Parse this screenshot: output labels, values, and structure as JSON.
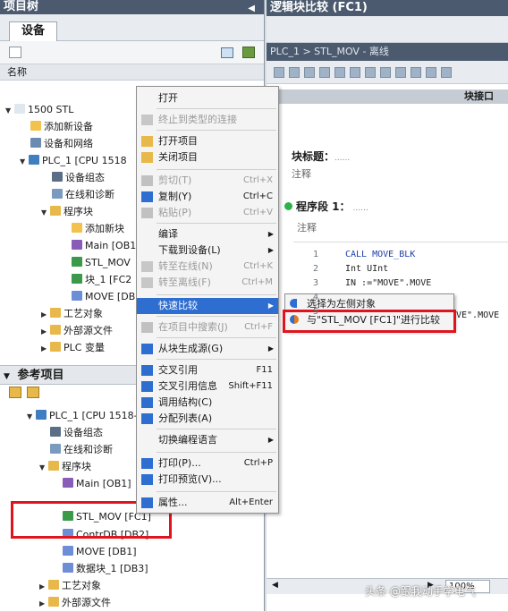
{
  "left": {
    "title": "项目树",
    "tab": "设备",
    "col_header": "名称",
    "tree": [
      {
        "label": "1500 STL",
        "icon": "project-icon"
      },
      {
        "label": "添加新设备",
        "icon": "add-device-icon"
      },
      {
        "label": "设备和网络",
        "icon": "network-icon"
      },
      {
        "label": "PLC_1 [CPU 1518",
        "icon": "plc-icon"
      },
      {
        "label": "设备组态",
        "icon": "device-config-icon"
      },
      {
        "label": "在线和诊断",
        "icon": "diagnostics-icon"
      },
      {
        "label": "程序块",
        "icon": "folder-icon"
      },
      {
        "label": "添加新块",
        "icon": "add-block-icon"
      },
      {
        "label": "Main [OB1",
        "icon": "ob-icon"
      },
      {
        "label": "STL_MOV",
        "icon": "fc-icon"
      },
      {
        "label": "块_1 [FC2",
        "icon": "fc-icon"
      },
      {
        "label": "MOVE [DB",
        "icon": "db-icon"
      },
      {
        "label": "工艺对象",
        "icon": "folder-icon"
      },
      {
        "label": "外部源文件",
        "icon": "folder-icon"
      },
      {
        "label": "PLC 变量",
        "icon": "folder-icon"
      }
    ],
    "ref_title": "参考项目",
    "ref_tree": [
      {
        "label": "PLC_1 [CPU 1518-",
        "icon": "plc-icon"
      },
      {
        "label": "设备组态",
        "icon": "device-config-icon"
      },
      {
        "label": "在线和诊断",
        "icon": "diagnostics-icon"
      },
      {
        "label": "程序块",
        "icon": "folder-icon"
      },
      {
        "label": "Main [OB1]",
        "icon": "ob-icon"
      },
      {
        "label": "STL_MOV [FC1]",
        "icon": "fc-icon"
      },
      {
        "label": "ContrDB [DB2]",
        "icon": "db-icon"
      },
      {
        "label": "MOVE [DB1]",
        "icon": "db-icon"
      },
      {
        "label": "数据块_1 [DB3]",
        "icon": "db-icon"
      },
      {
        "label": "工艺对象",
        "icon": "folder-icon"
      },
      {
        "label": "外部源文件",
        "icon": "folder-icon"
      }
    ]
  },
  "right": {
    "title": "逻辑块比较 (FC1)",
    "breadcrumb": "PLC_1 > STL_MOV - 离线",
    "block_header": "块接口",
    "block_title_label": "块标题：",
    "block_title_value": "......",
    "comment": "注释",
    "network_label": "程序段 1：",
    "network_value": "......",
    "network_comment": "注释",
    "code_lines": [
      {
        "no": "1",
        "text": "CALL  MOVE_BLK"
      },
      {
        "no": "2",
        "text": "   Int  UInt"
      },
      {
        "no": "3",
        "text": "   IN    :=\"MOVE\".MOVE"
      },
      {
        "no": "4",
        "text": ""
      },
      {
        "no": "5",
        "text": ""
      }
    ],
    "code_tail": "VE\".MOVE",
    "zoom": "100%",
    "watermark": "头条 @跟我动手学电气"
  },
  "menu": {
    "items": [
      {
        "label": "打开",
        "shortcut": "",
        "disabled": false
      },
      {
        "label": "终止到类型的连接",
        "shortcut": "",
        "disabled": true
      },
      {
        "label": "打开项目",
        "shortcut": "",
        "disabled": false
      },
      {
        "label": "关闭项目",
        "shortcut": "",
        "disabled": false
      },
      {
        "label": "剪切(T)",
        "shortcut": "Ctrl+X",
        "disabled": true
      },
      {
        "label": "复制(Y)",
        "shortcut": "Ctrl+C",
        "disabled": false
      },
      {
        "label": "粘贴(P)",
        "shortcut": "Ctrl+V",
        "disabled": true
      },
      {
        "label": "编译",
        "shortcut": "",
        "disabled": false
      },
      {
        "label": "下载到设备(L)",
        "shortcut": "",
        "disabled": false
      },
      {
        "label": "转至在线(N)",
        "shortcut": "Ctrl+K",
        "disabled": true
      },
      {
        "label": "转至离线(F)",
        "shortcut": "Ctrl+M",
        "disabled": true
      },
      {
        "label": "快速比较",
        "shortcut": "",
        "disabled": false
      },
      {
        "label": "在项目中搜索(J)",
        "shortcut": "Ctrl+F",
        "disabled": true
      },
      {
        "label": "从块生成源(G)",
        "shortcut": "",
        "disabled": false
      },
      {
        "label": "交叉引用",
        "shortcut": "F11",
        "disabled": false
      },
      {
        "label": "交叉引用信息",
        "shortcut": "Shift+F11",
        "disabled": false
      },
      {
        "label": "调用结构(C)",
        "shortcut": "",
        "disabled": false
      },
      {
        "label": "分配列表(A)",
        "shortcut": "",
        "disabled": false
      },
      {
        "label": "切换编程语言",
        "shortcut": "",
        "disabled": false
      },
      {
        "label": "打印(P)...",
        "shortcut": "Ctrl+P",
        "disabled": false
      },
      {
        "label": "打印预览(V)...",
        "shortcut": "",
        "disabled": false
      },
      {
        "label": "属性...",
        "shortcut": "Alt+Enter",
        "disabled": false
      }
    ],
    "submenu": [
      {
        "label": "选择为左侧对象"
      },
      {
        "label": "与\"STL_MOV [FC1]\"进行比较"
      }
    ]
  },
  "colors": {
    "accent": "#2f6ed1",
    "highlight_box": "#e0141e",
    "title_bg": "#4b5a6e"
  }
}
